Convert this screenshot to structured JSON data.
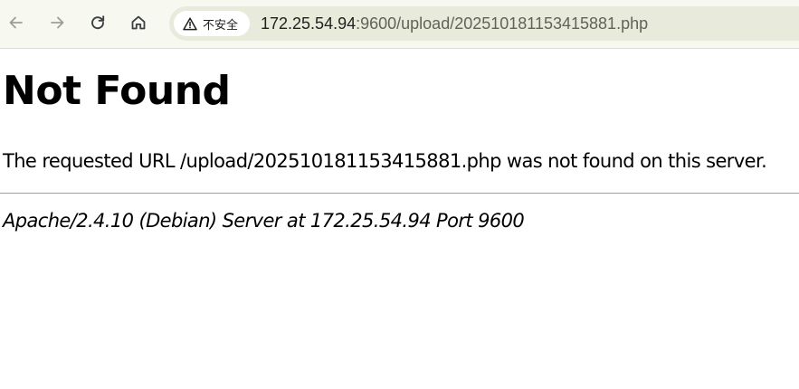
{
  "browser": {
    "nav": {
      "back_icon": "arrow-left-icon",
      "forward_icon": "arrow-right-icon",
      "reload_icon": "reload-icon",
      "home_icon": "home-icon"
    },
    "omnibox": {
      "security_icon": "warning-triangle-icon",
      "security_label": "不安全",
      "url_host": "172.25.54.94",
      "url_rest": ":9600/upload/20251018115341588 1.php"
    }
  },
  "page": {
    "title": "Not Found",
    "message": "The requested URL /upload/202510181153415881.php was not found on this server.",
    "footer": "Apache/2.4.10 (Debian) Server at 172.25.54.94 Port 9600"
  },
  "colors": {
    "toolbar_bg": "#f7f8ef",
    "omnibox_bg": "#e8ebdb",
    "text": "#000000",
    "rule": "#9e9e9e"
  }
}
